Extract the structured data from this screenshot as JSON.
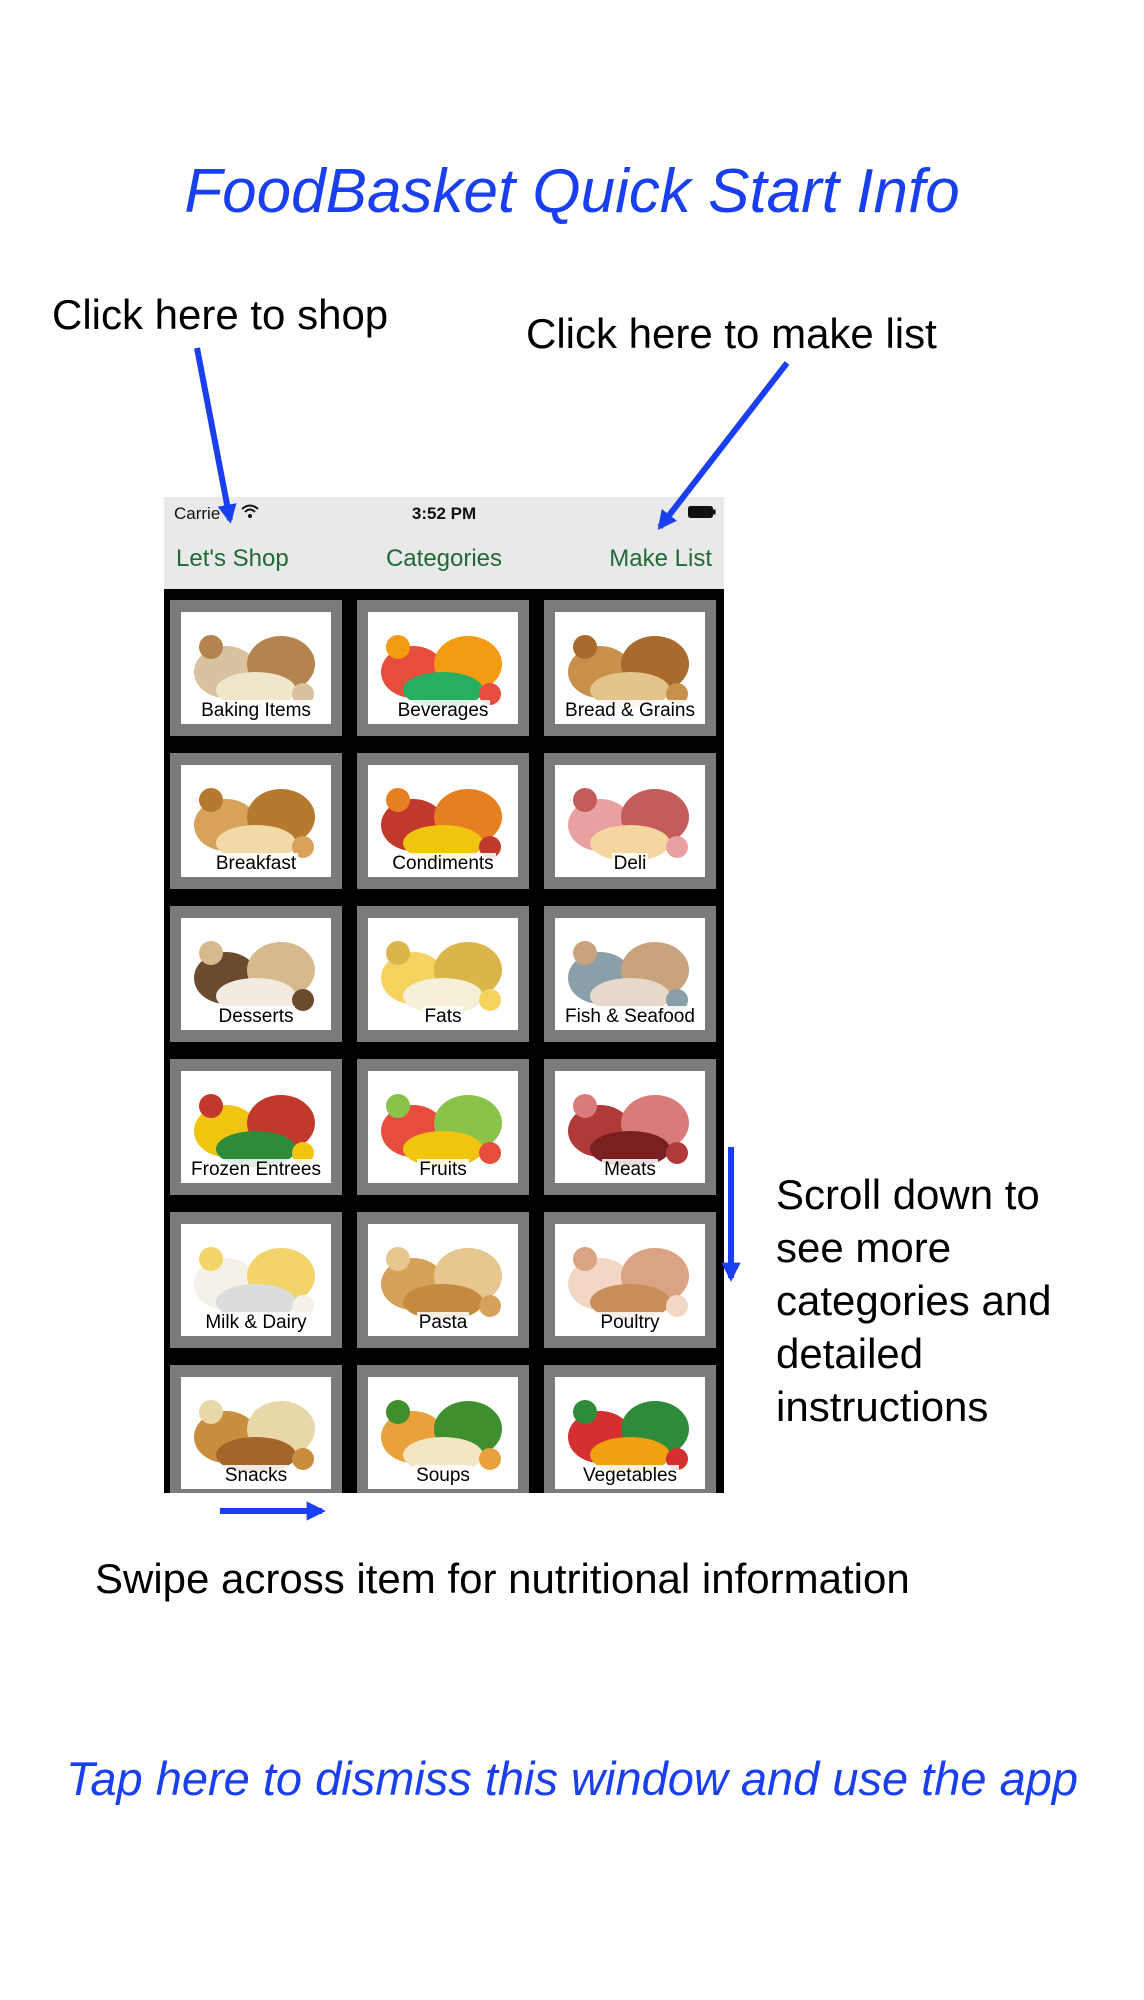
{
  "title": "FoodBasket Quick Start Info",
  "annotations": {
    "shop": "Click here to shop",
    "make_list": "Click here to make list",
    "scroll": "Scroll down to see more categories and detailed instructions",
    "swipe": "Swipe across item for nutritional information"
  },
  "dismiss": "Tap here to dismiss this window and use the app",
  "phone": {
    "status": {
      "carrier": "Carrie",
      "time": "3:52 PM"
    },
    "nav": {
      "left": "Let's Shop",
      "title": "Categories",
      "right": "Make List"
    },
    "categories": [
      {
        "label": "Baking Items",
        "icon": "baking-items-photo"
      },
      {
        "label": "Beverages",
        "icon": "beverages-photo"
      },
      {
        "label": "Bread & Grains",
        "icon": "bread-grains-photo"
      },
      {
        "label": "Breakfast",
        "icon": "breakfast-photo"
      },
      {
        "label": "Condiments",
        "icon": "condiments-photo"
      },
      {
        "label": "Deli",
        "icon": "deli-photo"
      },
      {
        "label": "Desserts",
        "icon": "desserts-photo"
      },
      {
        "label": "Fats",
        "icon": "fats-photo"
      },
      {
        "label": "Fish & Seafood",
        "icon": "fish-seafood-photo"
      },
      {
        "label": "Frozen Entrees",
        "icon": "frozen-entrees-photo"
      },
      {
        "label": "Fruits",
        "icon": "fruits-photo"
      },
      {
        "label": "Meats",
        "icon": "meats-photo"
      },
      {
        "label": "Milk & Dairy",
        "icon": "milk-dairy-photo"
      },
      {
        "label": "Pasta",
        "icon": "pasta-photo"
      },
      {
        "label": "Poultry",
        "icon": "poultry-photo"
      },
      {
        "label": "Snacks",
        "icon": "snacks-photo"
      },
      {
        "label": "Soups",
        "icon": "soups-photo"
      },
      {
        "label": "Vegetables",
        "icon": "vegetables-photo"
      }
    ]
  },
  "colors": {
    "accent_blue": "#1a3ff0",
    "nav_green": "#1e6b35",
    "tile_gray": "#7b7b7b"
  }
}
